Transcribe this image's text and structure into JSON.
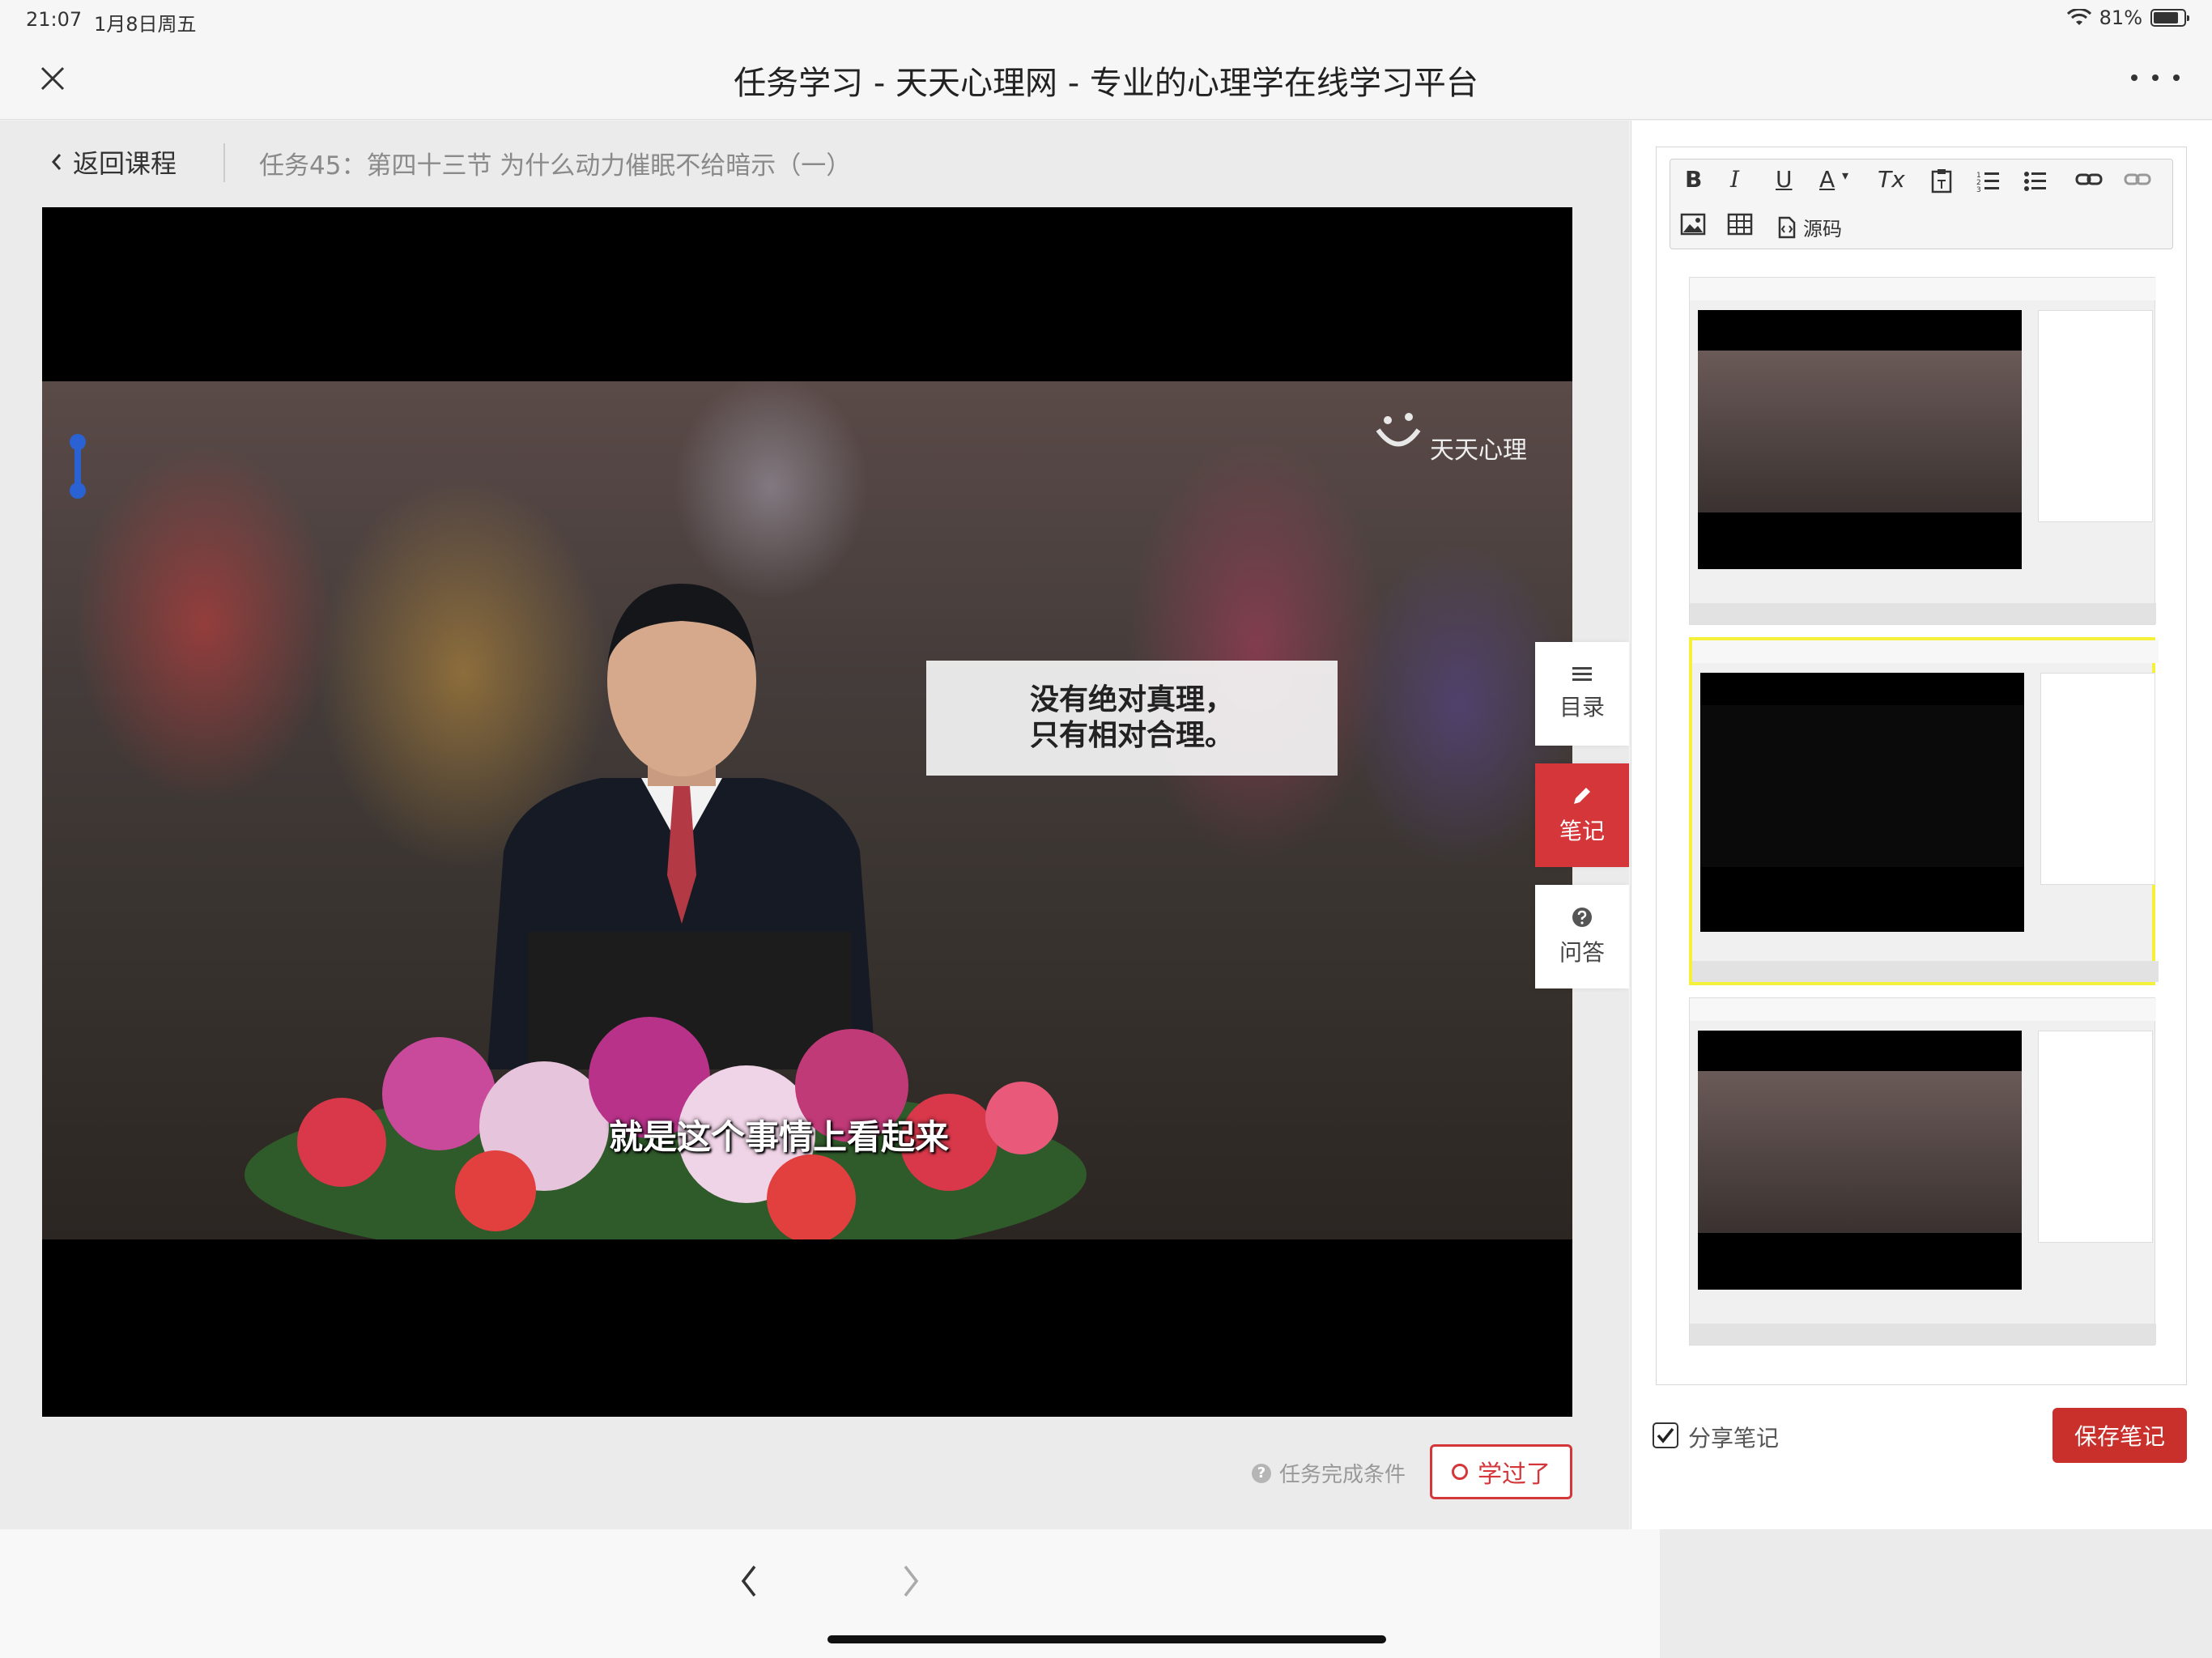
{
  "status": {
    "time": "21:07",
    "date": "1月8日周五",
    "battery": "81%",
    "icons": [
      "wifi-icon",
      "battery-icon"
    ]
  },
  "window": {
    "title": "任务学习 - 天天心理网 - 专业的心理学在线学习平台"
  },
  "breadcrumb": {
    "back_label": "返回课程",
    "lesson_title": "任务45：第四十三节 为什么动力催眠不给暗示（一）"
  },
  "video": {
    "logo_text": "天天心理",
    "overlay_line1": "没有绝对真理，",
    "overlay_line2": "只有相对合理。",
    "subtitle": "就是这个事情上看起来"
  },
  "side_tabs": {
    "toc": "目录",
    "note": "笔记",
    "qa": "问答"
  },
  "footer": {
    "task_condition": "任务完成条件",
    "learned_button": "学过了"
  },
  "editor": {
    "toolbar": [
      "B",
      "I",
      "U",
      "A",
      "Tx"
    ],
    "source_label": "源码",
    "share_label": "分享笔记",
    "save_button": "保存笔记"
  },
  "colors": {
    "accent": "#d4363a",
    "save": "#c9302c",
    "highlight": "#f5f03a",
    "link_blue": "#2a62d4"
  }
}
